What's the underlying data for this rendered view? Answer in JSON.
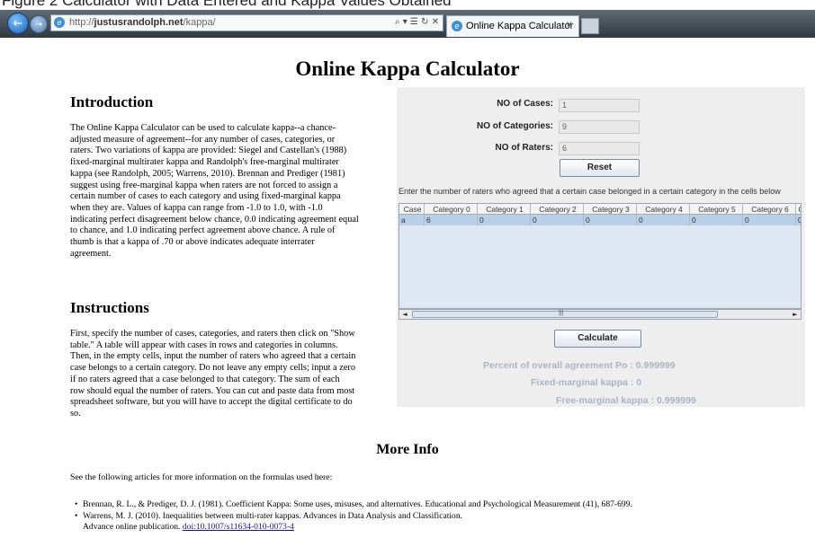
{
  "figure_caption": "Figure 2 Calculator with Data Entered and Kappa Values Obtained",
  "browser": {
    "url": "http://justusrandolph.net/kappa/",
    "url_prefix": "http://",
    "url_host": "justusrandolph.net",
    "url_path": "/kappa/",
    "address_tools": "⌕ ▾ ☰ ↻ ✕",
    "tab_title": "Online Kappa Calculator",
    "tab_close": "×",
    "back_glyph": "←",
    "forward_glyph": "→",
    "icons": [
      "back-icon",
      "forward-icon",
      "ie-page-icon",
      "search-icon",
      "refresh-icon",
      "stop-icon",
      "close-tab-icon"
    ]
  },
  "page": {
    "title": "Online Kappa Calculator",
    "intro_heading": "Introduction",
    "intro_lines": [
      "The Online Kappa Calculator can be used to calculate kappa--a chance-",
      "adjusted measure of agreement--for any number of cases, categories, or",
      "raters. Two variations of kappa are provided: Siegel and Castellan's (1988)",
      "fixed-marginal multirater kappa and Randolph's free-marginal multirater",
      "kappa (see Randolph, 2005; Warrens, 2010). Brennan and Prediger (1981)",
      "suggest using free-marginal kappa when raters are not forced to assign a",
      "certain number of cases to each category and using fixed-marginal kappa",
      "when they are. Values of kappa can range from -1.0 to 1.0, with -1.0",
      "indicating perfect disagreement below chance, 0.0 indicating agreement equal",
      "to chance, and 1.0 indicating perfect agreement above chance. A rule of",
      "thumb is that a kappa of .70 or above indicates adequate interrater",
      "agreement."
    ],
    "instructions_heading": "Instructions",
    "instructions_lines": [
      "First, specify the number of cases, categories, and raters then click on \"Show",
      "table.\" A table will appear with cases in rows and categories in columns.",
      "Then, in the empty cells, input the number of raters who agreed that a certain",
      "case belongs to a certain category. Do not leave any empty cells; input a zero",
      "if no raters agreed that a case belonged to that category. The sum of each",
      "row should equal the number of raters. You can cut and paste data from most",
      "spreadsheet software, but you will have to accept the digital certificate to do",
      "so."
    ],
    "more_info_heading": "More Info",
    "see_following": "See the following articles for more information on the formulas used here:",
    "references": [
      "Brennan, R. L., & Prediger, D. J. (1981). Coefficient Kappa: Some uses, misuses, and alternatives. Educational and Psychological Measurement (41), 687-699.",
      "Warrens, M. J. (2010). Inequalities between multi-rater kappas. Advances in Data Analysis and Classification."
    ],
    "ref2_continuation": "Advance online publication.",
    "doi_link": "doi:10.1007/s11634-010-0073-4"
  },
  "calculator": {
    "cases_label": "NO of Cases:",
    "cases_value": "1",
    "categories_label": "NO of Categories:",
    "categories_value": "9",
    "raters_label": "NO of Raters:",
    "raters_value": "6",
    "reset_label": "Reset",
    "table_instruction": "Enter the number of raters who agreed that a certain case belonged in a certain category in the cells below",
    "table_headers": [
      "Case",
      "Category 0",
      "Category 1",
      "Category 2",
      "Category 3",
      "Category 4",
      "Category 5",
      "Category 6",
      "C"
    ],
    "table_row": [
      "a",
      "6",
      "0",
      "0",
      "0",
      "0",
      "0",
      "0",
      "0"
    ],
    "scroll_left": "◄",
    "scroll_right": "►",
    "scroll_grip": "|||",
    "calculate_label": "Calculate",
    "po_result": "Percent of overall agreement Po : 0.999999",
    "fixed_result": "Fixed-marginal kappa : 0",
    "free_result": "Free-marginal kappa : 0.999999"
  }
}
